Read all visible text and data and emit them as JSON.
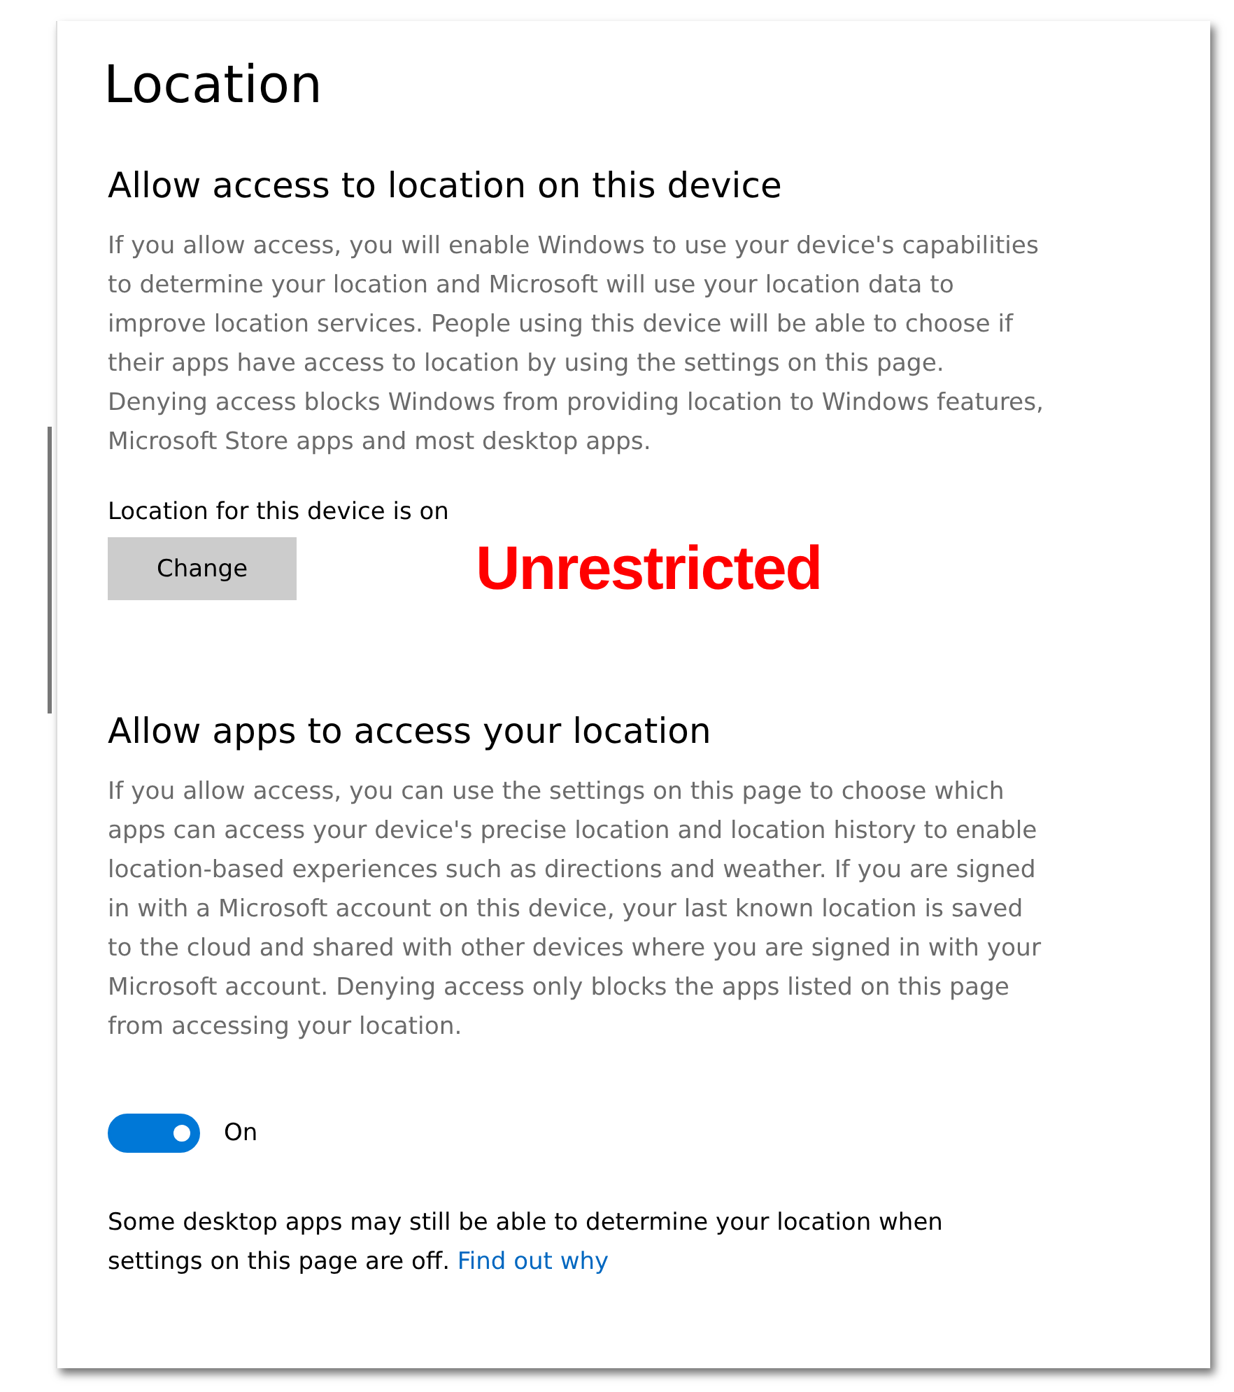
{
  "page_title": "Location",
  "device_section": {
    "heading": "Allow access to location on this device",
    "description": "If you allow access, you will enable Windows to use your device's capabilities to determine your location and Microsoft will use your location data to improve location services. People using this device will be able to choose if their apps have access to location by using the settings on this page. Denying access blocks Windows from providing location to Windows features, Microsoft Store apps and most desktop apps.",
    "status": "Location for this device is on",
    "button": "Change",
    "annotation": "Unrestricted"
  },
  "apps_section": {
    "heading": "Allow apps to access your location",
    "description": "If you allow access, you can use the settings on this page to choose which apps can access your device's precise location and location history to enable location-based experiences such as directions and weather. If you are signed in with a Microsoft account on this device, your last known location is saved to the cloud and shared with other devices where you are signed in with your Microsoft account. Denying access only blocks the apps listed on this page from accessing your location.",
    "toggle": {
      "on": true,
      "label": "On"
    }
  },
  "note": {
    "text": "Some desktop apps may still be able to determine your location when settings on this page are off.",
    "link": "Find out why"
  }
}
